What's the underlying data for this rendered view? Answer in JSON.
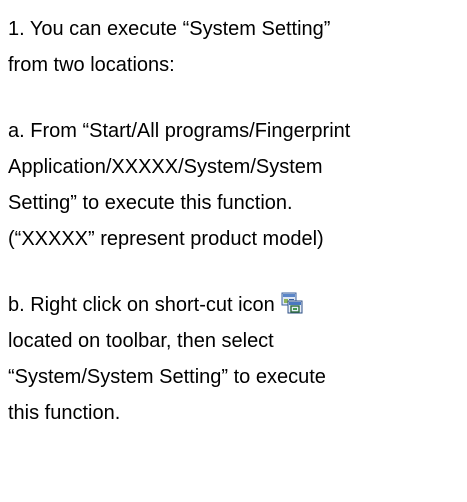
{
  "step1": {
    "lines": [
      "1. You can execute “System Setting”",
      "from two locations:"
    ]
  },
  "option_a": {
    "lines": [
      "a. From “Start/All programs/Fingerprint",
      "Application/XXXXX/System/System",
      "Setting” to execute this function.",
      "(“XXXXX” represent product model)"
    ]
  },
  "option_b": {
    "line1": "b. Right click on short-cut icon",
    "icon": "shortcut-app-icon",
    "lines": [
      "located on toolbar, then select",
      "“System/System Setting” to execute",
      "this function."
    ]
  }
}
